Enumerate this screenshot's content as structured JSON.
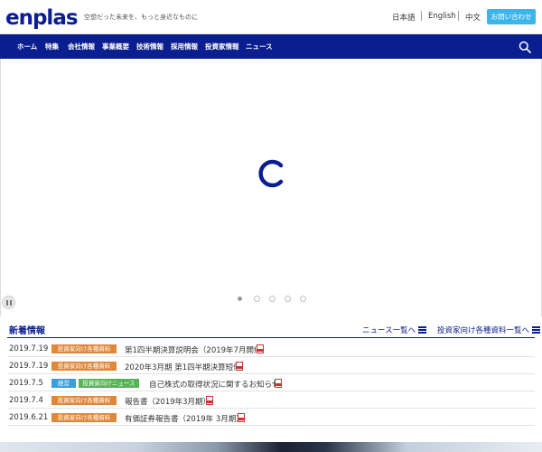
{
  "header": {
    "logo": "enplas",
    "tagline": "空想だった未来を、もっと身近なものに",
    "languages": [
      "日本語",
      "English",
      "中文"
    ],
    "contact_label": "お問い合わせ"
  },
  "nav": {
    "items": [
      "ホーム",
      "特集",
      "会社情報",
      "事業概要",
      "技術情報",
      "採用情報",
      "投資家情報",
      "ニュース"
    ]
  },
  "hero": {
    "slide_count": 5,
    "active_slide": 1
  },
  "news": {
    "title": "新着情報",
    "links": [
      "ニュース一覧へ",
      "投資家向け各種資料一覧へ"
    ],
    "items": [
      {
        "date": "2019.7.19",
        "badges": [
          {
            "label": "投資家向け各種資料",
            "type": "ir"
          }
        ],
        "text": "第1四半期決算説明会（2019年7月開催）"
      },
      {
        "date": "2019.7.19",
        "badges": [
          {
            "label": "投資家向け各種資料",
            "type": "ir"
          }
        ],
        "text": "2020年3月期 第1四半期決算短信"
      },
      {
        "date": "2019.7.5",
        "badges": [
          {
            "label": "経営",
            "type": "mgmt"
          },
          {
            "label": "投資家向けニュース",
            "type": "news"
          }
        ],
        "text": "自己株式の取得状況に関するお知らせ"
      },
      {
        "date": "2019.7.4",
        "badges": [
          {
            "label": "投資家向け各種資料",
            "type": "ir"
          }
        ],
        "text": "報告書（2019年3月期）"
      },
      {
        "date": "2019.6.21",
        "badges": [
          {
            "label": "投資家向け各種資料",
            "type": "ir"
          }
        ],
        "text": "有価証券報告書（2019年 3月期）"
      }
    ]
  },
  "colors": {
    "brand": "#0b1e8f",
    "accent": "#3cb6ea",
    "badge_ir": "#e0883a",
    "badge_mgmt": "#3aa0db",
    "badge_news": "#56b456"
  }
}
